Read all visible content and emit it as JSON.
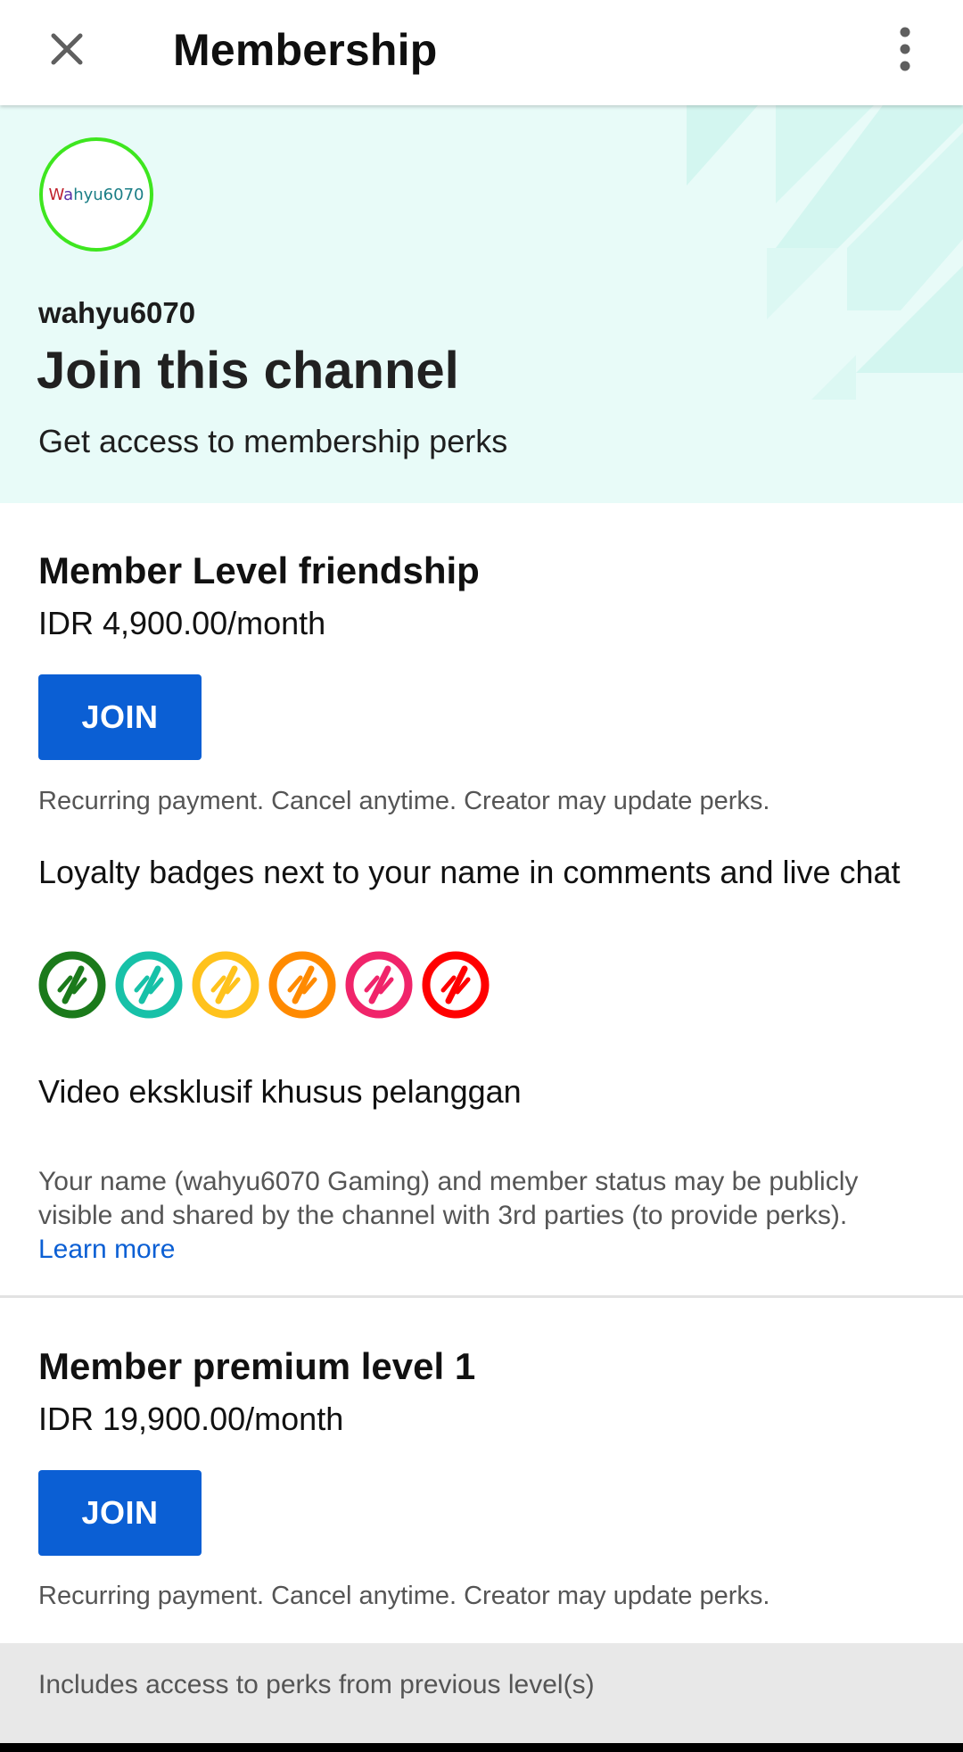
{
  "appbar": {
    "title": "Membership",
    "close_icon": "close-icon",
    "more_icon": "more-vertical-icon"
  },
  "hero": {
    "avatar_text": "Wahyu6070",
    "channel_handle": "wahyu6070",
    "heading": "Join this channel",
    "subheading": "Get access to membership perks",
    "background_color": "#e8fbf8"
  },
  "tiers": [
    {
      "title": "Member Level friendship",
      "price": "IDR 4,900.00/month",
      "join_label": "JOIN",
      "recurring_note": "Recurring payment. Cancel anytime. Creator may update perks.",
      "perks": [
        "Loyalty badges next to your name in comments and live chat",
        "Video eksklusif khusus pelanggan"
      ],
      "badge_colors": [
        "#1b7a1b",
        "#17c1a8",
        "#ffc21c",
        "#ff8a00",
        "#f0246a",
        "#ff0000"
      ],
      "privacy_note": "Your name (wahyu6070 Gaming) and member status may be publicly visible and shared by the channel with 3rd parties (to provide perks).",
      "learn_more": "Learn more"
    },
    {
      "title": "Member premium level 1",
      "price": "IDR 19,900.00/month",
      "join_label": "JOIN",
      "recurring_note": "Recurring payment. Cancel anytime. Creator may update perks.",
      "includes_note": "Includes access to perks from previous level(s)"
    }
  ],
  "colors": {
    "accent": "#0b5fd4",
    "avatar_ring": "#3ee61f"
  }
}
